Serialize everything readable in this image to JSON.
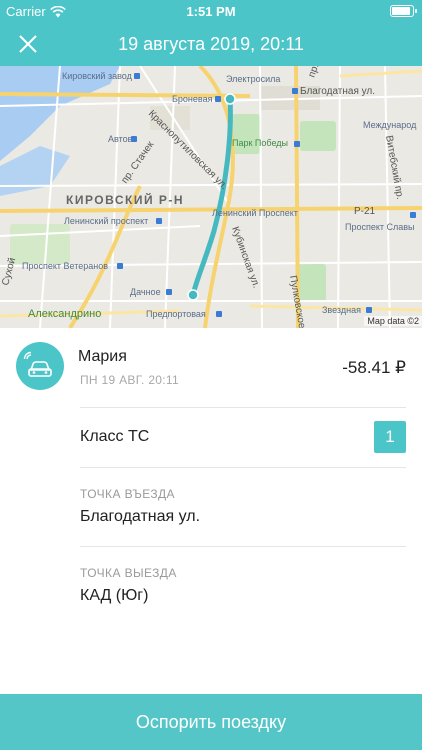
{
  "status_bar": {
    "carrier": "Carrier",
    "time": "1:51 PM",
    "battery_level": 0.9
  },
  "header": {
    "title": "19 августа 2019, 20:11",
    "close_icon": "close-icon"
  },
  "map": {
    "labels": {
      "kirovsky_zavod": "Кировский завод",
      "elektrosila": "Электросила",
      "blagodatnaya": "Благодатная ул.",
      "yuri_gagarina": "пр. Юрия Гагарина",
      "mezhdunarodnaya": "Международ",
      "bronevaya": "Броневая",
      "avtovo": "Автово",
      "krasnoputilovskaya": "Краснопутиловская ул.",
      "stachek": "пр. Стачек",
      "park_pobedy": "Парк Победы",
      "kirovsky_rn": "КИРОВСКИЙ Р-Н",
      "leninsky_prospekt_1": "Ленинский проспект",
      "leninsky_prospekt_2": "Ленинский Проспект",
      "r21": "Р-21",
      "prospekt_slavy": "Проспект Славы",
      "vitebsky": "Витебский пр.",
      "prospekt_veteranov": "Проспект Ветеранов",
      "kubinskaya": "Кубинская ул.",
      "pulkovskoe": "Пулковское",
      "dachnoe": "Дачное",
      "aleksandrino": "Александрино",
      "predportovaya": "Предпортовая",
      "zvezdnaya": "Звездная",
      "sukhoy": "Сухой",
      "map_data": "Map data ©2"
    }
  },
  "trip": {
    "driver_name": "Мария",
    "date": "ПН 19 АВГ. 20:11",
    "amount": "-58.41 ₽",
    "avatar_icon": "car-icon"
  },
  "vehicle_class": {
    "label": "Класс ТС",
    "value": "1"
  },
  "entry": {
    "caption": "ТОЧКА ВЪЕЗДА",
    "value": "Благодатная ул."
  },
  "exit": {
    "caption": "ТОЧКА ВЫЕЗДА",
    "value": "КАД (Юг)"
  },
  "dispute_button": {
    "label": "Оспорить поездку"
  },
  "colors": {
    "accent": "#4cc5c8",
    "route": "#45b9bf"
  }
}
